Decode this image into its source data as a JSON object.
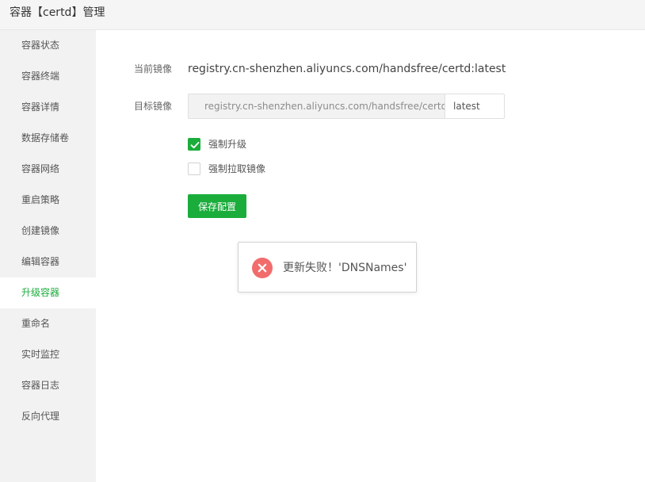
{
  "header": {
    "title": "容器【certd】管理"
  },
  "sidebar": {
    "items": [
      {
        "label": "容器状态",
        "active": false
      },
      {
        "label": "容器终端",
        "active": false
      },
      {
        "label": "容器详情",
        "active": false
      },
      {
        "label": "数据存储卷",
        "active": false
      },
      {
        "label": "容器网络",
        "active": false
      },
      {
        "label": "重启策略",
        "active": false
      },
      {
        "label": "创建镜像",
        "active": false
      },
      {
        "label": "编辑容器",
        "active": false
      },
      {
        "label": "升级容器",
        "active": true
      },
      {
        "label": "重命名",
        "active": false
      },
      {
        "label": "实时监控",
        "active": false
      },
      {
        "label": "容器日志",
        "active": false
      },
      {
        "label": "反向代理",
        "active": false
      }
    ]
  },
  "form": {
    "current_image_label": "当前镜像",
    "current_image_value": "registry.cn-shenzhen.aliyuncs.com/handsfree/certd:latest",
    "target_image_label": "目标镜像",
    "target_image_value": "registry.cn-shenzhen.aliyuncs.com/handsfree/certd",
    "target_tag_value": "latest",
    "force_upgrade": {
      "label": "强制升级",
      "checked": true
    },
    "force_pull": {
      "label": "强制拉取镜像",
      "checked": false
    },
    "save_label": "保存配置"
  },
  "toast": {
    "icon": "error-circle-icon",
    "message": "更新失败！'DNSNames'"
  },
  "colors": {
    "accent": "#1aad3b",
    "error": "#f26c6c"
  }
}
